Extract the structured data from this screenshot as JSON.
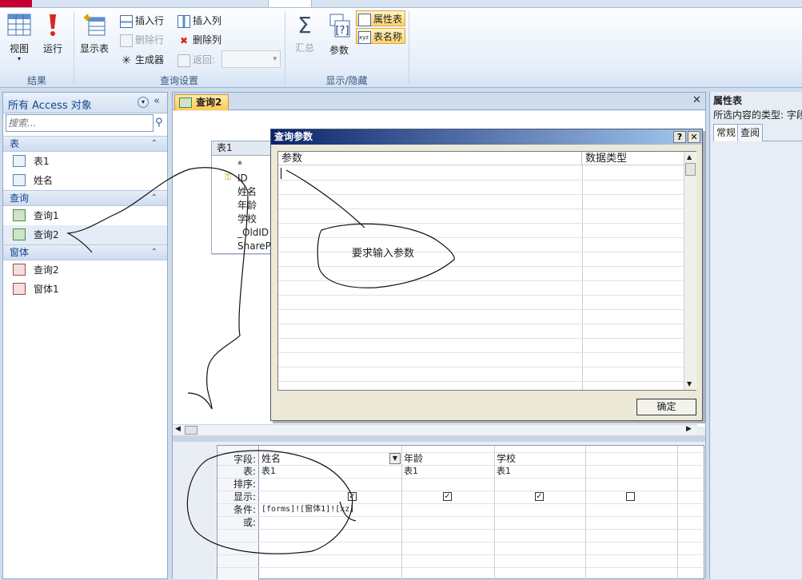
{
  "ribbon": {
    "groups": {
      "results": "结果",
      "query_setup": "查询设置",
      "show_hide": "显示/隐藏"
    },
    "view_label": "视图",
    "run_label": "运行",
    "show_table_label": "显示表",
    "insert_row_label": "插入行",
    "delete_row_label": "删除行",
    "builder_label": "生成器",
    "insert_column_label": "插入列",
    "delete_column_label": "删除列",
    "return_label": "返回:",
    "totals_label": "汇总",
    "parameters_label": "参数",
    "property_sheet_label": "属性表",
    "table_names_label": "表名称"
  },
  "nav": {
    "title": "所有 Access 对象",
    "search_placeholder": "搜索...",
    "sections": [
      {
        "label": "表",
        "items": [
          "表1",
          "姓名"
        ]
      },
      {
        "label": "查询",
        "items": [
          "查询1",
          "查询2"
        ]
      },
      {
        "label": "窗体",
        "items": [
          "查询2",
          "窗体1"
        ]
      }
    ]
  },
  "document": {
    "tab_label": "查询2",
    "table_box": {
      "title": "表1",
      "fields": [
        "*",
        "ID",
        "姓名",
        "年龄",
        "学校",
        "_OldID",
        "ShareP"
      ]
    }
  },
  "grid": {
    "row_labels": [
      "字段:",
      "表:",
      "排序:",
      "显示:",
      "条件:",
      "或:"
    ],
    "columns": [
      {
        "field": "姓名",
        "table": "表1",
        "show": true,
        "criteria": "[forms]![窗体1]![xz]"
      },
      {
        "field": "年龄",
        "table": "表1",
        "show": true,
        "criteria": ""
      },
      {
        "field": "学校",
        "table": "表1",
        "show": true,
        "criteria": ""
      },
      {
        "field": "",
        "table": "",
        "show": false,
        "criteria": ""
      }
    ]
  },
  "dialog": {
    "title": "查询参数",
    "help": "?",
    "close": "✕",
    "col_param": "参数",
    "col_type": "数据类型",
    "ok_label": "确定"
  },
  "props": {
    "title": "属性表",
    "subtitle": "所选内容的类型: 字段",
    "tabs": [
      "常规",
      "查阅"
    ]
  },
  "annotation": {
    "text": "要求输入参数"
  },
  "colors": {
    "accent": "#ffc956",
    "title_bar": "#0b246a"
  }
}
